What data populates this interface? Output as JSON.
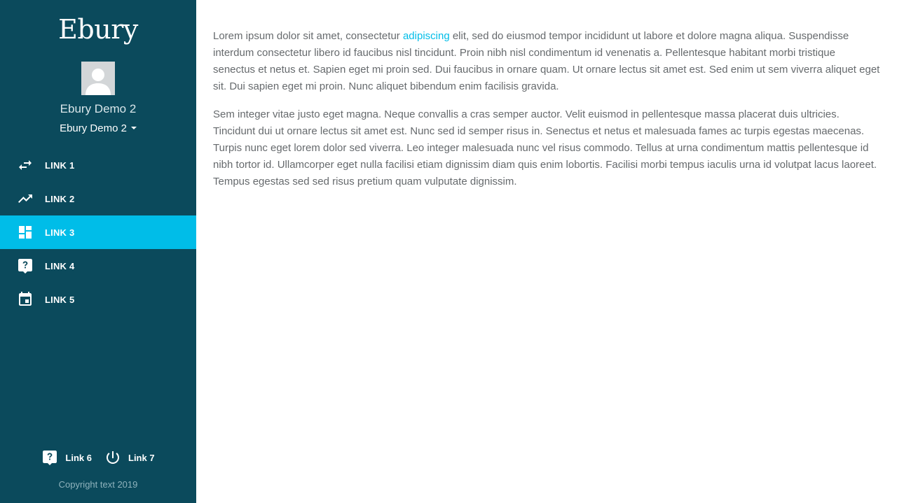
{
  "brand": {
    "logo_text": "Ebury"
  },
  "user": {
    "name": "Ebury Demo 2",
    "account_selector": "Ebury Demo 2"
  },
  "nav": {
    "items": [
      {
        "label": "LINK 1",
        "icon": "swap-arrows-icon",
        "active": false
      },
      {
        "label": "LINK 2",
        "icon": "trending-up-icon",
        "active": false
      },
      {
        "label": "LINK 3",
        "icon": "dashboard-icon",
        "active": true
      },
      {
        "label": "LINK 4",
        "icon": "help-chat-icon",
        "active": false
      },
      {
        "label": "LINK 5",
        "icon": "calendar-icon",
        "active": false
      }
    ]
  },
  "footer": {
    "links": [
      {
        "label": "Link 6",
        "icon": "help-chat-icon"
      },
      {
        "label": "Link 7",
        "icon": "power-icon"
      }
    ],
    "copyright": "Copyright text 2019"
  },
  "content": {
    "p1_before": "Lorem ipsum dolor sit amet, consectetur ",
    "p1_link": "adipiscing",
    "p1_after": " elit, sed do eiusmod tempor incididunt ut labore et dolore magna aliqua. Suspendisse interdum consectetur libero id faucibus nisl tincidunt. Proin nibh nisl condimentum id venenatis a. Pellentesque habitant morbi tristique senectus et netus et. Sapien eget mi proin sed. Dui faucibus in ornare quam. Ut ornare lectus sit amet est. Sed enim ut sem viverra aliquet eget sit. Dui sapien eget mi proin. Nunc aliquet bibendum enim facilisis gravida.",
    "p2": "Sem integer vitae justo eget magna. Neque convallis a cras semper auctor. Velit euismod in pellentesque massa placerat duis ultricies. Tincidunt dui ut ornare lectus sit amet est. Nunc sed id semper risus in. Senectus et netus et malesuada fames ac turpis egestas maecenas. Turpis nunc eget lorem dolor sed viverra. Leo integer malesuada nunc vel risus commodo. Tellus at urna condimentum mattis pellentesque id nibh tortor id. Ullamcorper eget nulla facilisi etiam dignissim diam quis enim lobortis. Facilisi morbi tempus iaculis urna id volutpat lacus laoreet. Tempus egestas sed sed risus pretium quam vulputate dignissim."
  },
  "colors": {
    "sidebar_bg": "#0b4a5c",
    "accent": "#00bde8",
    "body_text": "#666a6d"
  }
}
